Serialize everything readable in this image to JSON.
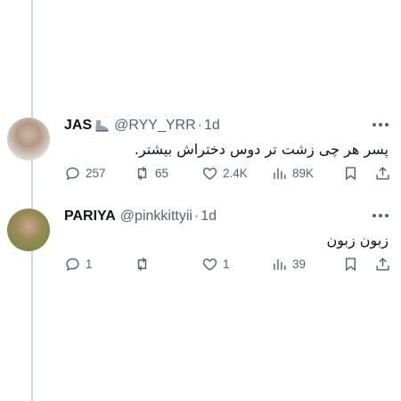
{
  "tweets": [
    {
      "name": "JAS",
      "handle": "@RYY_YRR",
      "separator": "·",
      "time": "1d",
      "text": "پسر هر چی زشت تر دوس دختراش بیشتر.",
      "replies": "257",
      "retweets": "65",
      "likes": "2.4K",
      "views": "89K"
    },
    {
      "name": "PARIYA",
      "handle": "@pinkkittyii",
      "separator": "·",
      "time": "1d",
      "text": "زبون زبون",
      "replies": "1",
      "retweets": "",
      "likes": "1",
      "views": "39"
    }
  ],
  "icons": {
    "more": "more-horizontal-icon",
    "reply": "reply-bubble-icon",
    "retweet": "retweet-icon",
    "like": "heart-icon",
    "views": "analytics-bars-icon",
    "bookmark": "bookmark-icon",
    "share": "share-icon",
    "name_emoji": "boot-emoji-icon"
  },
  "colors": {
    "text": "#0f1419",
    "secondary": "#536471",
    "thread_line": "#cfd9de"
  }
}
